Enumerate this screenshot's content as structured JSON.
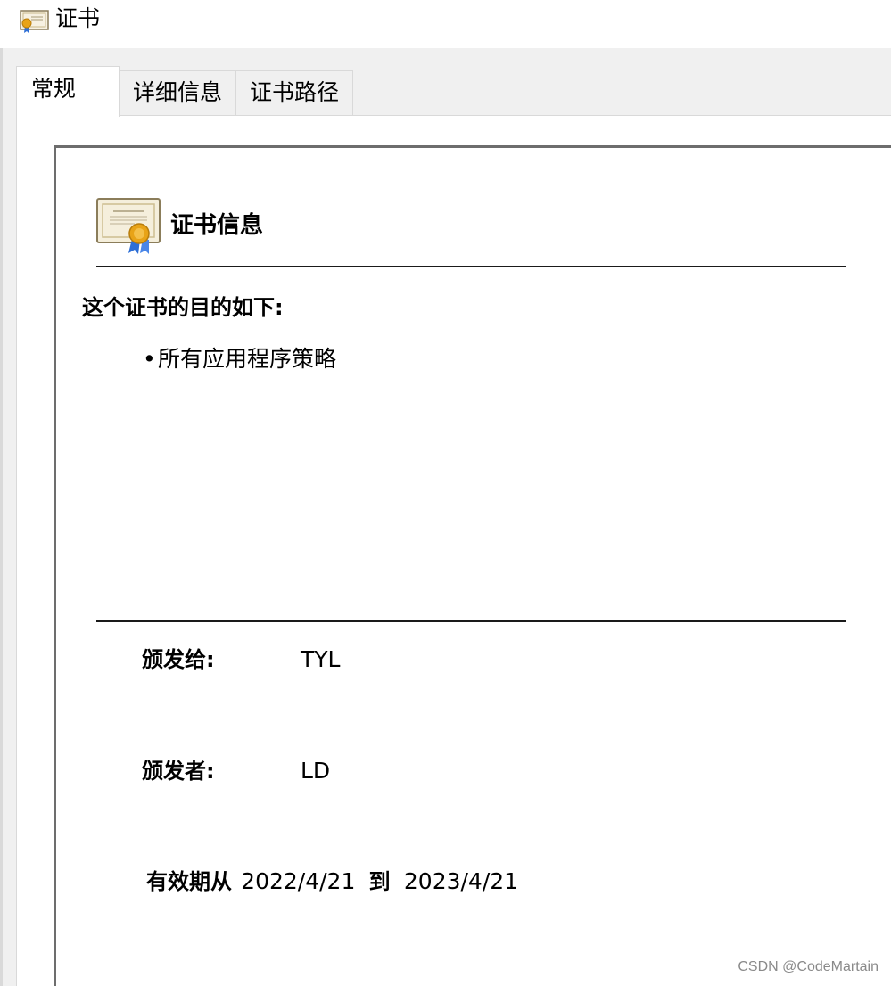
{
  "window": {
    "title": "证书",
    "icon": "certificate-icon"
  },
  "tabs": [
    {
      "label": "常规",
      "active": true
    },
    {
      "label": "详细信息",
      "active": false
    },
    {
      "label": "证书路径",
      "active": false
    }
  ],
  "info": {
    "title": "证书信息",
    "purpose_heading": "这个证书的目的如下:",
    "purposes": [
      "所有应用程序策略"
    ],
    "bullet": "•",
    "issued_to_label": "颁发给:",
    "issued_to_value": "TYL",
    "issued_by_label": "颁发者:",
    "issued_by_value": "LD",
    "valid_from_label": "有效期从",
    "valid_from": "2022/4/21",
    "valid_to_label": "到",
    "valid_to": "2023/4/21"
  },
  "watermark": "CSDN @CodeMartain",
  "colors": {
    "ribbon": "#2e6fd6",
    "seal": "#e8a317",
    "frame": "#6d6d6d"
  }
}
